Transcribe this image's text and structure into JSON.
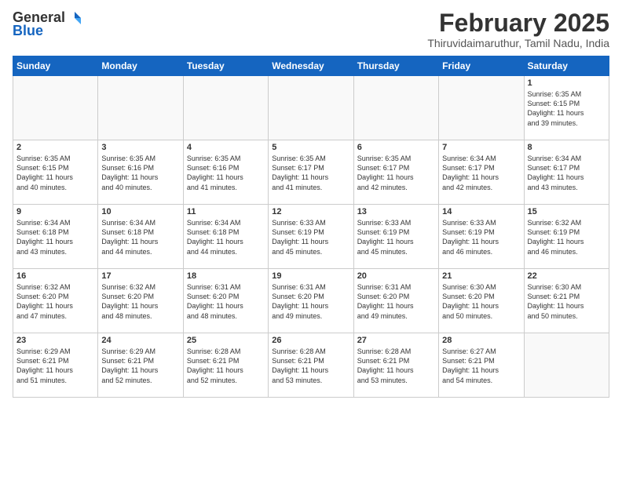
{
  "logo": {
    "general": "General",
    "blue": "Blue"
  },
  "header": {
    "month_year": "February 2025",
    "location": "Thiruvidaimaruthur, Tamil Nadu, India"
  },
  "weekdays": [
    "Sunday",
    "Monday",
    "Tuesday",
    "Wednesday",
    "Thursday",
    "Friday",
    "Saturday"
  ],
  "weeks": [
    [
      {
        "day": "",
        "info": ""
      },
      {
        "day": "",
        "info": ""
      },
      {
        "day": "",
        "info": ""
      },
      {
        "day": "",
        "info": ""
      },
      {
        "day": "",
        "info": ""
      },
      {
        "day": "",
        "info": ""
      },
      {
        "day": "1",
        "info": "Sunrise: 6:35 AM\nSunset: 6:15 PM\nDaylight: 11 hours\nand 39 minutes."
      }
    ],
    [
      {
        "day": "2",
        "info": "Sunrise: 6:35 AM\nSunset: 6:15 PM\nDaylight: 11 hours\nand 40 minutes."
      },
      {
        "day": "3",
        "info": "Sunrise: 6:35 AM\nSunset: 6:16 PM\nDaylight: 11 hours\nand 40 minutes."
      },
      {
        "day": "4",
        "info": "Sunrise: 6:35 AM\nSunset: 6:16 PM\nDaylight: 11 hours\nand 41 minutes."
      },
      {
        "day": "5",
        "info": "Sunrise: 6:35 AM\nSunset: 6:17 PM\nDaylight: 11 hours\nand 41 minutes."
      },
      {
        "day": "6",
        "info": "Sunrise: 6:35 AM\nSunset: 6:17 PM\nDaylight: 11 hours\nand 42 minutes."
      },
      {
        "day": "7",
        "info": "Sunrise: 6:34 AM\nSunset: 6:17 PM\nDaylight: 11 hours\nand 42 minutes."
      },
      {
        "day": "8",
        "info": "Sunrise: 6:34 AM\nSunset: 6:17 PM\nDaylight: 11 hours\nand 43 minutes."
      }
    ],
    [
      {
        "day": "9",
        "info": "Sunrise: 6:34 AM\nSunset: 6:18 PM\nDaylight: 11 hours\nand 43 minutes."
      },
      {
        "day": "10",
        "info": "Sunrise: 6:34 AM\nSunset: 6:18 PM\nDaylight: 11 hours\nand 44 minutes."
      },
      {
        "day": "11",
        "info": "Sunrise: 6:34 AM\nSunset: 6:18 PM\nDaylight: 11 hours\nand 44 minutes."
      },
      {
        "day": "12",
        "info": "Sunrise: 6:33 AM\nSunset: 6:19 PM\nDaylight: 11 hours\nand 45 minutes."
      },
      {
        "day": "13",
        "info": "Sunrise: 6:33 AM\nSunset: 6:19 PM\nDaylight: 11 hours\nand 45 minutes."
      },
      {
        "day": "14",
        "info": "Sunrise: 6:33 AM\nSunset: 6:19 PM\nDaylight: 11 hours\nand 46 minutes."
      },
      {
        "day": "15",
        "info": "Sunrise: 6:32 AM\nSunset: 6:19 PM\nDaylight: 11 hours\nand 46 minutes."
      }
    ],
    [
      {
        "day": "16",
        "info": "Sunrise: 6:32 AM\nSunset: 6:20 PM\nDaylight: 11 hours\nand 47 minutes."
      },
      {
        "day": "17",
        "info": "Sunrise: 6:32 AM\nSunset: 6:20 PM\nDaylight: 11 hours\nand 48 minutes."
      },
      {
        "day": "18",
        "info": "Sunrise: 6:31 AM\nSunset: 6:20 PM\nDaylight: 11 hours\nand 48 minutes."
      },
      {
        "day": "19",
        "info": "Sunrise: 6:31 AM\nSunset: 6:20 PM\nDaylight: 11 hours\nand 49 minutes."
      },
      {
        "day": "20",
        "info": "Sunrise: 6:31 AM\nSunset: 6:20 PM\nDaylight: 11 hours\nand 49 minutes."
      },
      {
        "day": "21",
        "info": "Sunrise: 6:30 AM\nSunset: 6:20 PM\nDaylight: 11 hours\nand 50 minutes."
      },
      {
        "day": "22",
        "info": "Sunrise: 6:30 AM\nSunset: 6:21 PM\nDaylight: 11 hours\nand 50 minutes."
      }
    ],
    [
      {
        "day": "23",
        "info": "Sunrise: 6:29 AM\nSunset: 6:21 PM\nDaylight: 11 hours\nand 51 minutes."
      },
      {
        "day": "24",
        "info": "Sunrise: 6:29 AM\nSunset: 6:21 PM\nDaylight: 11 hours\nand 52 minutes."
      },
      {
        "day": "25",
        "info": "Sunrise: 6:28 AM\nSunset: 6:21 PM\nDaylight: 11 hours\nand 52 minutes."
      },
      {
        "day": "26",
        "info": "Sunrise: 6:28 AM\nSunset: 6:21 PM\nDaylight: 11 hours\nand 53 minutes."
      },
      {
        "day": "27",
        "info": "Sunrise: 6:28 AM\nSunset: 6:21 PM\nDaylight: 11 hours\nand 53 minutes."
      },
      {
        "day": "28",
        "info": "Sunrise: 6:27 AM\nSunset: 6:21 PM\nDaylight: 11 hours\nand 54 minutes."
      },
      {
        "day": "",
        "info": ""
      }
    ]
  ]
}
